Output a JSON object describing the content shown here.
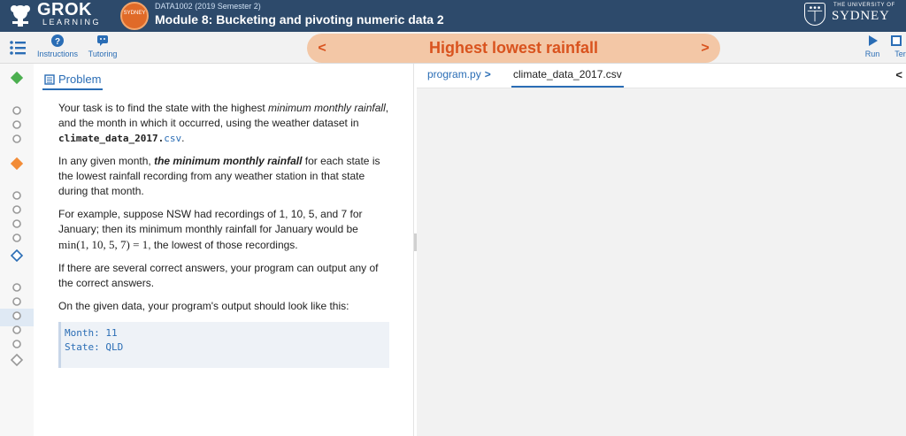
{
  "header": {
    "brand_name": "GROK",
    "brand_sub": "LEARNING",
    "course_badge": "SYDNEY",
    "course_code": "DATA1002 (2019 Semester 2)",
    "module_title": "Module 8: Bucketing and pivoting numeric data 2",
    "university_small": "THE UNIVERSITY OF",
    "university_name": "SYDNEY",
    "color": "#2d4a6b"
  },
  "toolbar": {
    "instructions_label": "Instructions",
    "tutoring_label": "Tutoring",
    "problem_title": "Highest lowest rainfall",
    "prev_glyph": "<",
    "next_glyph": ">",
    "run_label": "Run",
    "terminal_label": "Terr",
    "accent": "#d9531e"
  },
  "problem": {
    "tab_label": "Problem",
    "p1_a": "Your task is to find the state with the highest ",
    "p1_em": "minimum monthly rainfall",
    "p1_b": ", and the month in which it occurred, using the weather dataset in ",
    "p1_file": "climate_data_2017.",
    "p1_ext": "csv",
    "p1_end": ".",
    "p2_a": "In any given month, ",
    "p2_strong": "the minimum monthly rainfall",
    "p2_b": " for each state is the lowest rainfall recording from any weather station in that state during that month.",
    "p3_a": "For example, suppose NSW had recordings of 1, 10, 5, and 7 for January; then its minimum monthly rainfall for January would be ",
    "p3_math": "min(1, 10, 5, 7) = 1",
    "p3_b": ", the lowest of those recordings.",
    "p4": "If there are several correct answers, your program can output any of the correct answers.",
    "p5": "On the given data, your program's output should look like this:",
    "output": "Month: 11\nState: QLD"
  },
  "editor": {
    "tab_program": "program.py",
    "tab_program_arrow": ">",
    "tab_csv": "climate_data_2017.csv",
    "collapse_glyph": "<"
  },
  "rail": {
    "items": [
      "diamond-done",
      "circle",
      "circle",
      "circle",
      "diamond-warn",
      "circle",
      "circle",
      "circle",
      "circle",
      "diamond-current",
      "circle",
      "circle",
      "circle",
      "circle",
      "circle",
      "diamond"
    ]
  }
}
